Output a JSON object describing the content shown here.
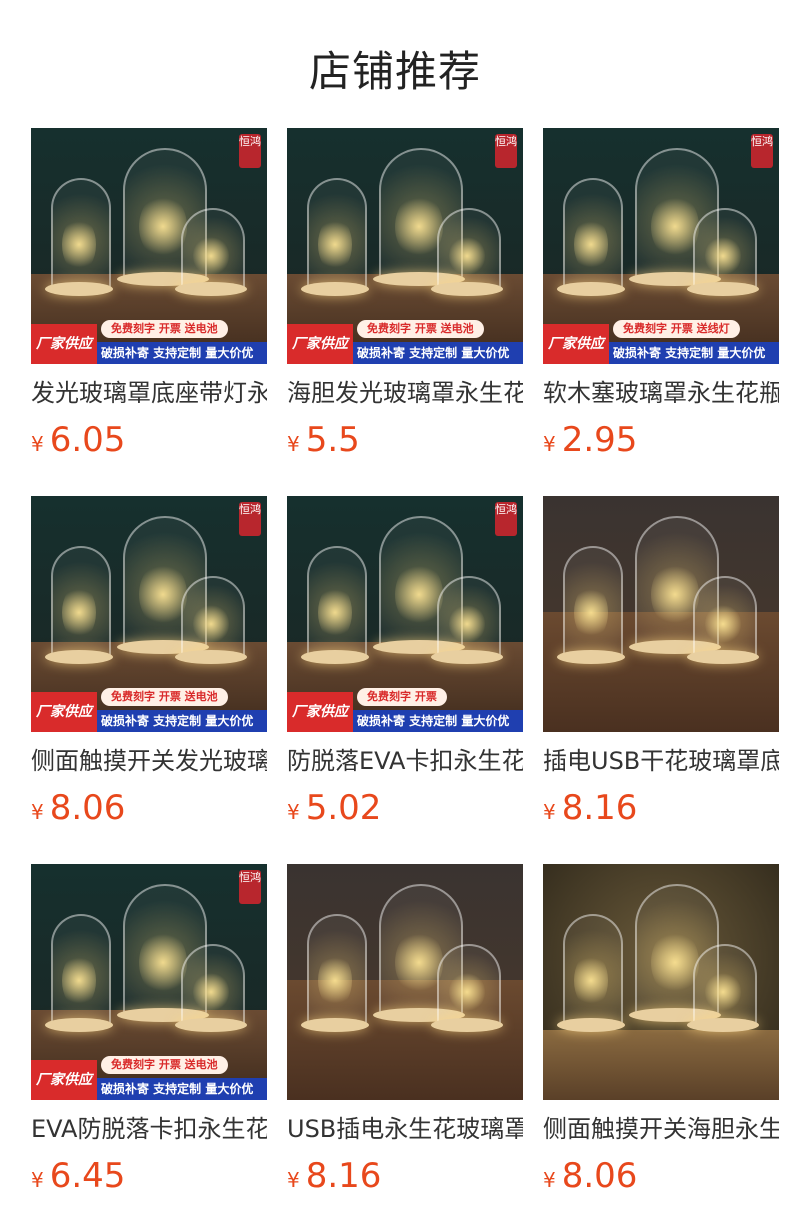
{
  "header": {
    "title": "店铺推荐"
  },
  "products": [
    {
      "name": "发光玻璃罩底座带灯永生花",
      "price": "6.05",
      "currency": "¥",
      "seal": "恒鸿",
      "banner": {
        "left": "厂家供应",
        "top": "免费刻字 开票 送电池",
        "bottom": "破损补寄 支持定制 量大价优"
      },
      "theme": "dark"
    },
    {
      "name": "海胆发光玻璃罩永生花底座",
      "price": "5.5",
      "currency": "¥",
      "seal": "恒鸿",
      "banner": {
        "left": "厂家供应",
        "top": "免费刻字 开票 送电池",
        "bottom": "破损补寄 支持定制 量大价优"
      },
      "theme": "dark"
    },
    {
      "name": "软木塞玻璃罩永生花瓶",
      "price": "2.95",
      "currency": "¥",
      "seal": "恒鸿",
      "banner": {
        "left": "厂家供应",
        "top": "免费刻字 开票 送线灯",
        "bottom": "破损补寄 支持定制 量大价优"
      },
      "theme": "dark"
    },
    {
      "name": "侧面触摸开关发光玻璃罩",
      "price": "8.06",
      "currency": "¥",
      "seal": "恒鸿",
      "banner": {
        "left": "厂家供应",
        "top": "免费刻字 开票 送电池",
        "bottom": "破损补寄 支持定制 量大价优"
      },
      "theme": "dark"
    },
    {
      "name": "防脱落EVA卡扣永生花玻璃罩",
      "price": "5.02",
      "currency": "¥",
      "seal": "恒鸿",
      "banner": {
        "left": "厂家供应",
        "top": "免费刻字 开票",
        "bottom": "破损补寄 支持定制 量大价优"
      },
      "theme": "dark"
    },
    {
      "name": "插电USB干花玻璃罩底座",
      "price": "8.16",
      "currency": "¥",
      "seal": "",
      "banner": null,
      "theme": "wood"
    },
    {
      "name": "EVA防脱落卡扣永生花玻璃罩",
      "price": "6.45",
      "currency": "¥",
      "seal": "恒鸿",
      "banner": {
        "left": "厂家供应",
        "top": "免费刻字 开票 送电池",
        "bottom": "破损补寄 支持定制 量大价优"
      },
      "theme": "dark"
    },
    {
      "name": "USB插电永生花玻璃罩底座",
      "price": "8.16",
      "currency": "¥",
      "seal": "",
      "banner": null,
      "theme": "wood"
    },
    {
      "name": "侧面触摸开关海胆永生花",
      "price": "8.06",
      "currency": "¥",
      "seal": "",
      "banner": null,
      "theme": "warm"
    }
  ]
}
